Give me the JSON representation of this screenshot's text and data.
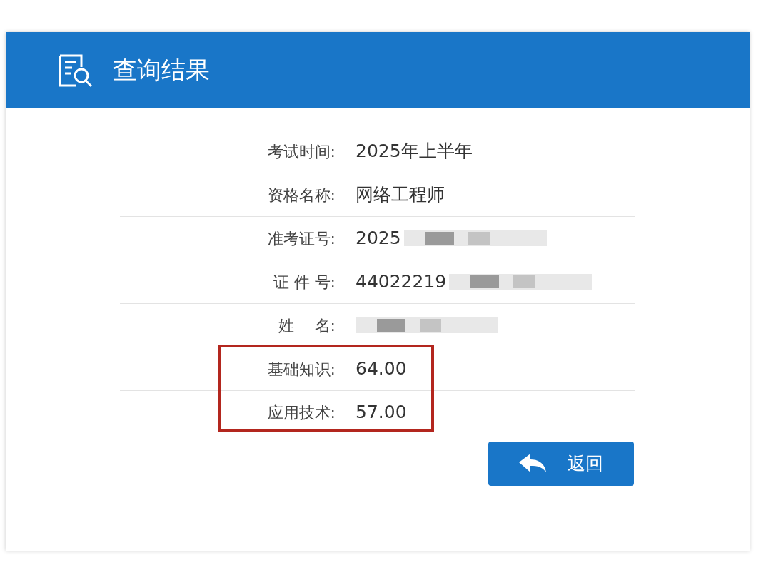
{
  "header": {
    "title": "查询结果"
  },
  "rows": [
    {
      "label": "考试时间:",
      "value": "2025年上半年",
      "redacted": false,
      "highlighted": false
    },
    {
      "label": "资格名称:",
      "value": "网络工程师",
      "redacted": false,
      "highlighted": false
    },
    {
      "label": "准考证号:",
      "value": "2025",
      "redacted": true,
      "highlighted": false
    },
    {
      "label": "证 件 号:",
      "value": "44022219",
      "redacted": true,
      "highlighted": false
    },
    {
      "label": "姓　 名:",
      "redacted": true,
      "highlighted": false
    },
    {
      "label": "基础知识:",
      "value": "64.00",
      "redacted": false,
      "highlighted": true
    },
    {
      "label": "应用技术:",
      "value": "57.00",
      "redacted": false,
      "highlighted": true
    }
  ],
  "back_button": {
    "label": "返回"
  }
}
